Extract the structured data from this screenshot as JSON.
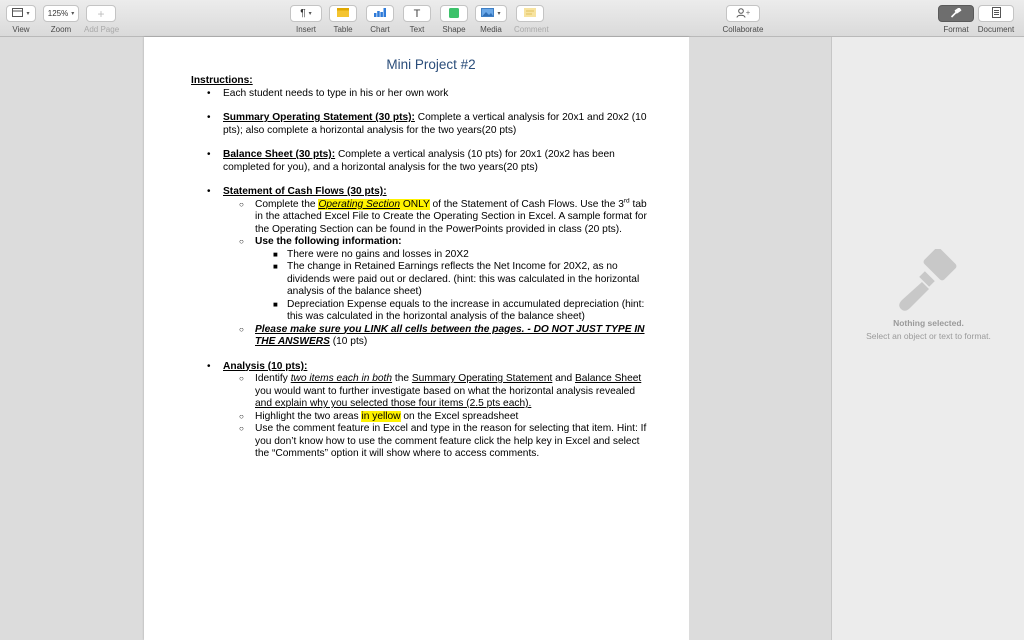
{
  "toolbar": {
    "view": {
      "label": "View"
    },
    "zoom": {
      "value": "125%",
      "label": "Zoom"
    },
    "add_page": {
      "label": "Add Page"
    },
    "insert": {
      "glyph": "¶",
      "label": "Insert"
    },
    "table": {
      "label": "Table"
    },
    "chart": {
      "label": "Chart"
    },
    "text": {
      "glyph": "T",
      "label": "Text"
    },
    "shape": {
      "label": "Shape"
    },
    "media": {
      "label": "Media"
    },
    "comment": {
      "label": "Comment"
    },
    "collaborate": {
      "label": "Collaborate"
    },
    "format": {
      "label": "Format"
    },
    "document": {
      "label": "Document"
    }
  },
  "inspector": {
    "title": "Nothing selected.",
    "subtitle": "Select an object or text to format."
  },
  "doc": {
    "title": "Mini Project #2",
    "instructions": "Instructions:",
    "b1": "Each student needs to type in his or her own work",
    "b2_head": "Summary Operating Statement (30 pts):",
    "b2_text": " Complete a vertical analysis for 20x1 and 20x2 (10 pts); also complete a horizontal analysis for the two years(20 pts)",
    "b3_head": "Balance Sheet (30 pts):",
    "b3_text": " Complete a vertical analysis (10 pts) for 20x1 (20x2 has been completed for you), and a horizontal analysis  for the two years(20 pts)",
    "b4_head": "Statement of Cash Flows (30 pts):",
    "b4_s1_a": "Complete the ",
    "b4_s1_hl": "Operating Section",
    "b4_s1_only": " ONLY",
    "b4_s1_b": " of the Statement of Cash Flows.  Use the 3",
    "b4_s1_sup": "rd",
    "b4_s1_c": " tab in the attached Excel File to Create the Operating Section in Excel.  A sample format for the Operating Section can be found in the PowerPoints provided in class (20 pts).",
    "b4_s2": "Use the following information:",
    "b4_s2_i1": "There were no gains and losses in 20X2",
    "b4_s2_i2": "The change in Retained Earnings reflects the Net Income for 20X2, as no dividends were paid out or declared. (hint: this was calculated in the horizontal analysis of the balance sheet)",
    "b4_s2_i3": "Depreciation Expense equals to the increase in accumulated depreciation (hint: this was calculated in the horizontal analysis of the balance sheet)",
    "b4_s3_bi": "Please make sure you LINK all cells between the pages. - DO NOT JUST TYPE IN THE ANSWERS",
    "b4_s3_tail": " (10 pts)",
    "b5_head": "Analysis (10 pts):",
    "b5_s1_a": "Identify ",
    "b5_s1_i": "two items each in both",
    "b5_s1_b": " the ",
    "b5_s1_u1": "Summary Operating Statement",
    "b5_s1_c": " and ",
    "b5_s1_u2": "Balance Sheet",
    "b5_s1_d": " you would want to further investigate based on what the horizontal analysis revealed ",
    "b5_s1_u3": "and explain why you selected those four items (2.5 pts each).",
    "b5_s2_a": "Highlight the two areas ",
    "b5_s2_hl": "in yellow",
    "b5_s2_b": " on the Excel spreadsheet",
    "b5_s3": "Use the comment feature in Excel and type in the reason for selecting that item.  Hint:  If you don’t know how to use the comment feature click the help key in Excel and select the “Comments” option it will show where to access comments."
  },
  "colors": {
    "title_blue": "#2a4d7a",
    "highlight": "#fff200",
    "chart_blue": "#2f7bd9",
    "shape_green": "#3cc26a",
    "table_yellow": "#f4c430"
  }
}
